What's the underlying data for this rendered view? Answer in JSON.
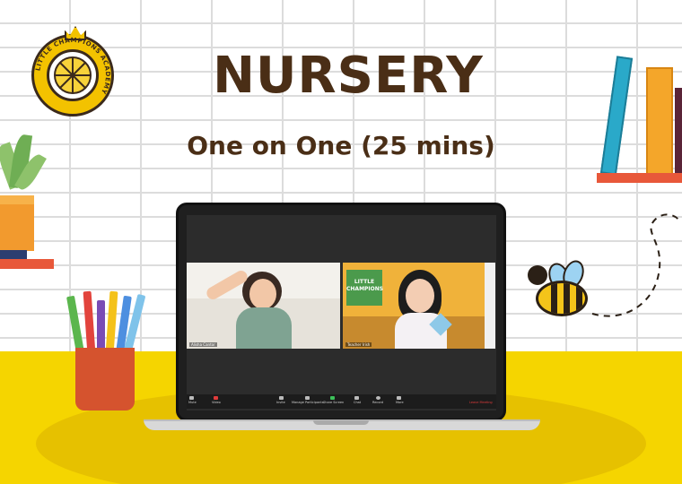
{
  "header": {
    "title": "NURSERY",
    "subtitle": "One on One (25 mins)"
  },
  "logo": {
    "text": "LITTLE CHAMPIONS ACADEMY",
    "icon": "lemon-crown-logo"
  },
  "video_call": {
    "participants": [
      {
        "name": "Alisha Cantor",
        "tile": "student"
      },
      {
        "name": "Teacher Irish",
        "tile": "teacher"
      }
    ],
    "teacher_board_text": "LITTLE CHAMPIONS",
    "toolbar": {
      "items": [
        {
          "label": "Mute",
          "icon": "microphone-icon"
        },
        {
          "label": "Video",
          "icon": "video-camera-icon"
        },
        {
          "label": "Invite",
          "icon": "invite-icon"
        },
        {
          "label": "Manage Participants",
          "icon": "participants-icon"
        },
        {
          "label": "Share Screen",
          "icon": "share-screen-icon"
        },
        {
          "label": "Chat",
          "icon": "chat-icon"
        },
        {
          "label": "Record",
          "icon": "record-icon"
        },
        {
          "label": "More",
          "icon": "more-icon"
        }
      ],
      "leave_label": "Leave Meeting"
    }
  },
  "colors": {
    "title": "#4a2e16",
    "floor": "#f5d500",
    "leave": "#e03b3b"
  }
}
